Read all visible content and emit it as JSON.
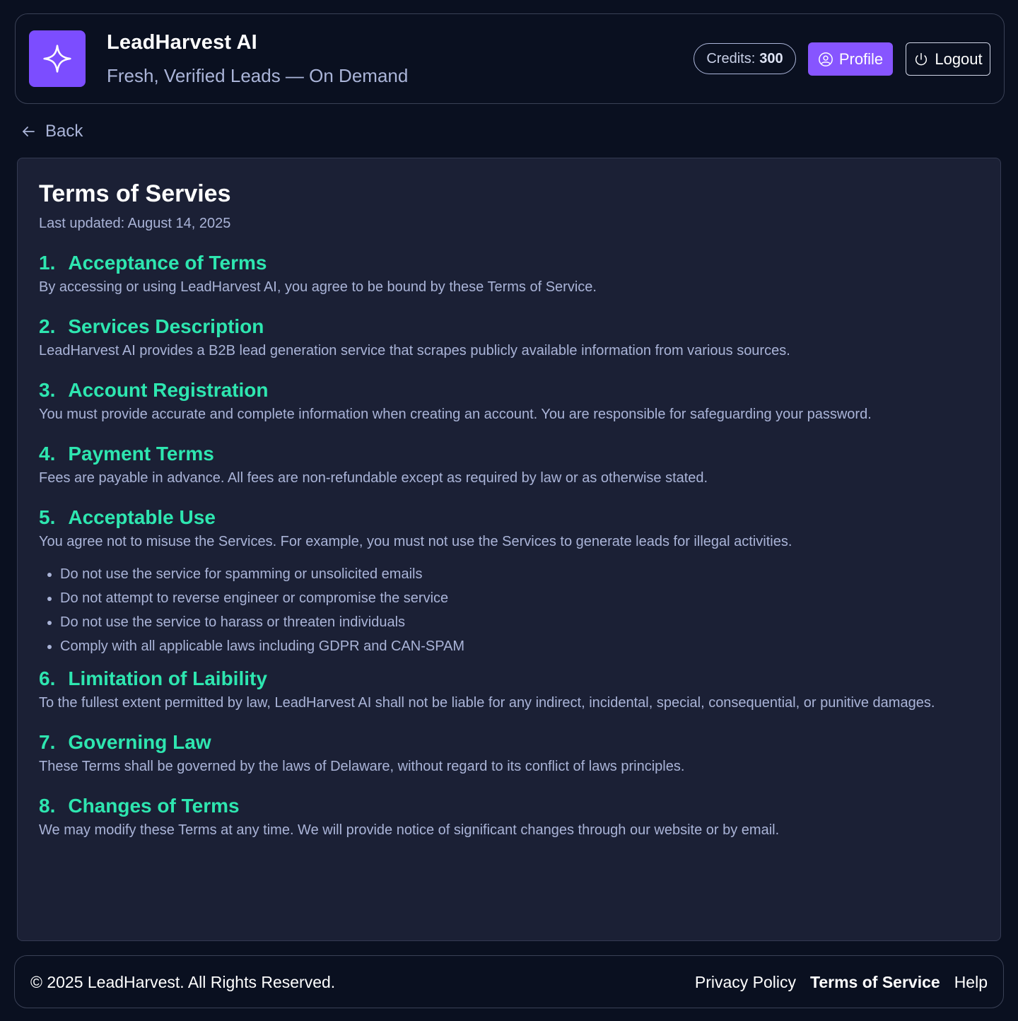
{
  "header": {
    "title": "LeadHarvest AI",
    "tagline": "Fresh, Verified Leads — On Demand",
    "credits_label": "Credits:",
    "credits_value": "300",
    "profile_label": "Profile",
    "logout_label": "Logout",
    "logo_icon": "sparkle-icon",
    "accent_color": "#8755ff"
  },
  "nav": {
    "back_label": "Back"
  },
  "page": {
    "title": "Terms of Servies",
    "last_updated": "Last updated: August 14, 2025",
    "heading_color": "#2ee6b0",
    "sections": [
      {
        "num": "1.",
        "title": "Acceptance of Terms",
        "body": "By accessing or using LeadHarvest AI, you agree to be bound by these Terms of Service."
      },
      {
        "num": "2.",
        "title": "Services Description",
        "body": "LeadHarvest AI provides a B2B lead generation service that scrapes publicly available information from various sources."
      },
      {
        "num": "3.",
        "title": "Account Registration",
        "body": "You must provide accurate and complete information when creating an account. You are responsible for safeguarding your password."
      },
      {
        "num": "4.",
        "title": "Payment Terms",
        "body": "Fees are payable in advance. All fees are non-refundable except as required by law or as otherwise stated."
      },
      {
        "num": "5.",
        "title": "Acceptable Use",
        "body": "You agree not to misuse the Services. For example, you must not use the Services to generate leads for illegal activities.",
        "bullets": [
          "Do not use the service for spamming or unsolicited emails",
          "Do not attempt to reverse engineer or compromise the service",
          "Do not use the service to harass or threaten individuals",
          "Comply with all applicable laws including GDPR and CAN-SPAM"
        ]
      },
      {
        "num": "6.",
        "title": "Limitation of Laibility",
        "body": "To the fullest extent permitted by law, LeadHarvest AI shall not be liable for any indirect, incidental, special, consequential, or punitive damages."
      },
      {
        "num": "7.",
        "title": "Governing Law",
        "body": "These Terms shall be governed by the laws of Delaware, without regard to its conflict of laws principles."
      },
      {
        "num": "8.",
        "title": "Changes of Terms",
        "body": "We may modify these Terms at any time. We will provide notice of significant changes through our website or by email."
      }
    ]
  },
  "footer": {
    "copyright": "© 2025 LeadHarvest. All Rights Reserved.",
    "links": [
      "Privacy Policy",
      "Terms of Service",
      "Help"
    ]
  }
}
